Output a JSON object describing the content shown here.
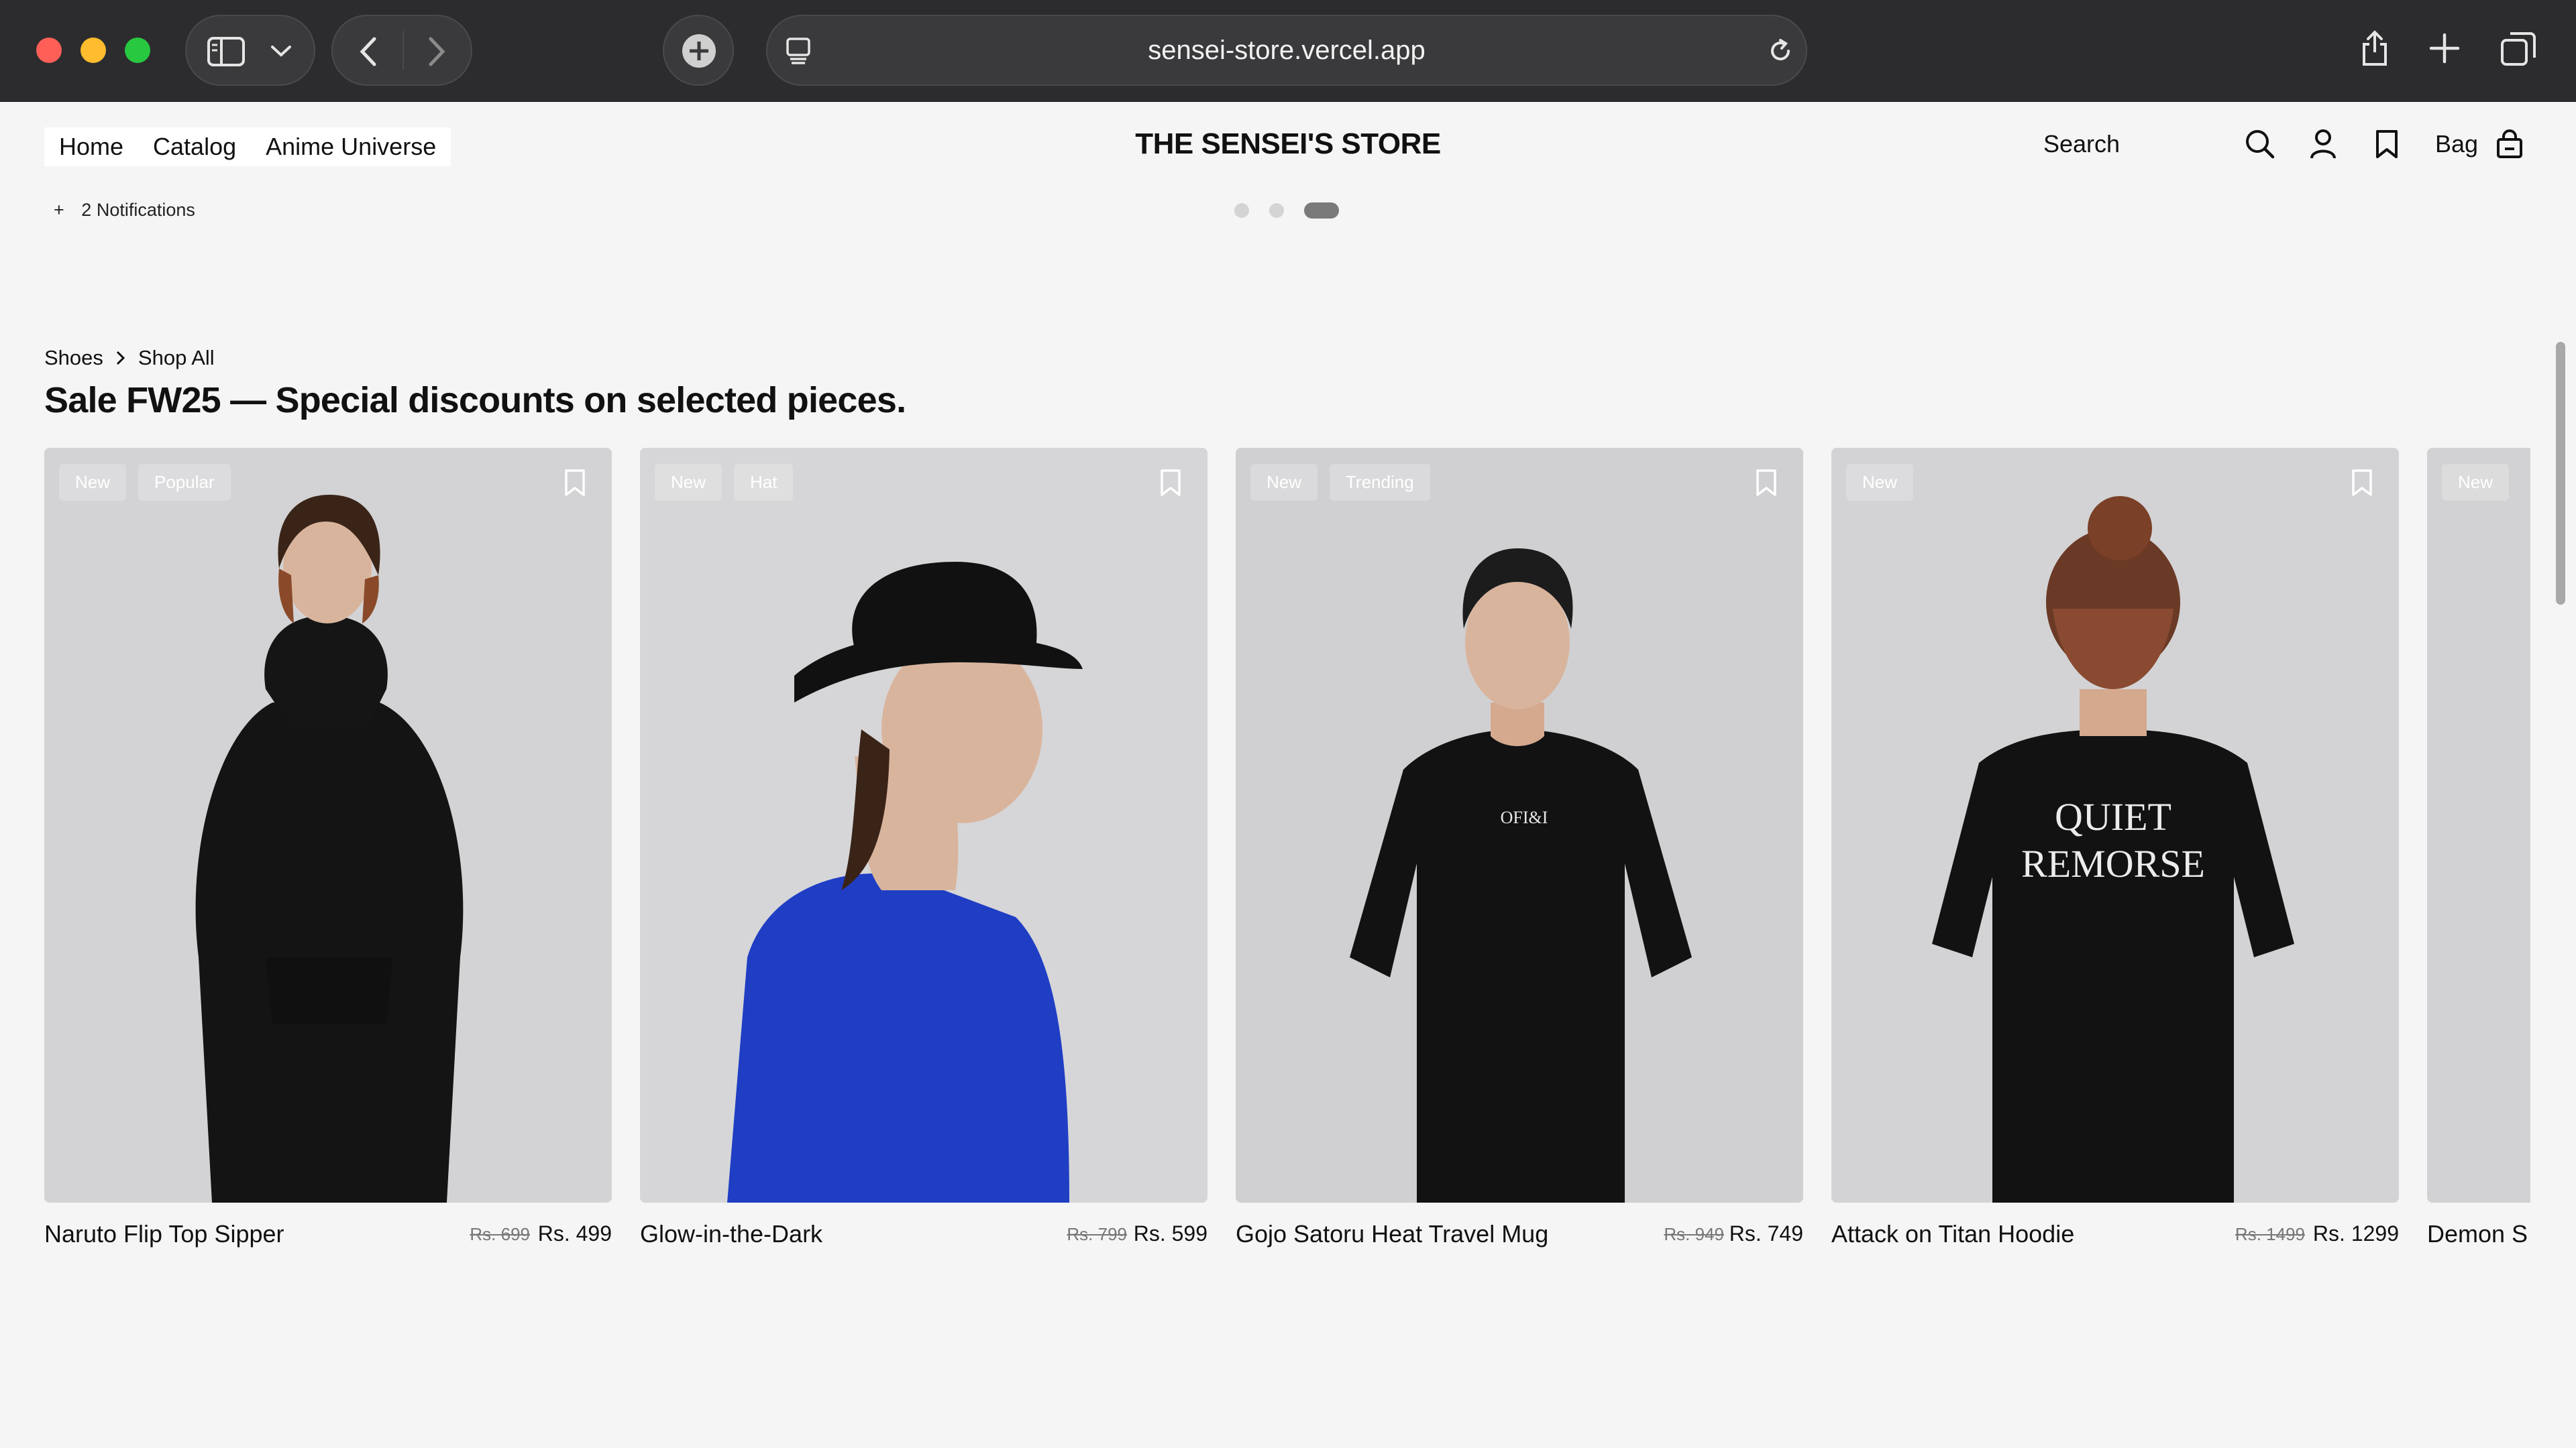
{
  "browser": {
    "url": "sensei-store.vercel.app"
  },
  "header": {
    "nav": [
      "Home",
      "Catalog",
      "Anime Universe"
    ],
    "title": "THE SENSEI'S STORE",
    "search_label": "Search",
    "bag_label": "Bag"
  },
  "notifications": {
    "label": "2 Notifications"
  },
  "carousel": {
    "slides": 3,
    "active_slide": 3
  },
  "breadcrumb": {
    "items": [
      "Shoes",
      "Shop All"
    ]
  },
  "page_title": "Sale FW25 — Special discounts on selected pieces.",
  "products": [
    {
      "name": "Naruto Flip Top Sipper",
      "badges": [
        "New",
        "Popular"
      ],
      "old_price": "Rs. 699",
      "price": "Rs. 499"
    },
    {
      "name": "Glow-in-the-Dark",
      "badges": [
        "New",
        "Hat"
      ],
      "old_price": "Rs. 799",
      "price": "Rs. 599"
    },
    {
      "name": "Gojo Satoru Heat Travel Mug",
      "badges": [
        "New",
        "Trending"
      ],
      "old_price": "Rs. 949",
      "price": "Rs. 749"
    },
    {
      "name": "Attack on Titan Hoodie",
      "badges": [
        "New"
      ],
      "old_price": "Rs. 1499",
      "price": "Rs. 1299"
    },
    {
      "name": "Demon S",
      "badges": [
        "New"
      ],
      "old_price": "",
      "price": ""
    }
  ],
  "colors": {
    "page_bg": "#f5f5f5",
    "card_bg": "#d2d2d4",
    "chrome_bg": "#2c2c2e",
    "text": "#111111"
  }
}
